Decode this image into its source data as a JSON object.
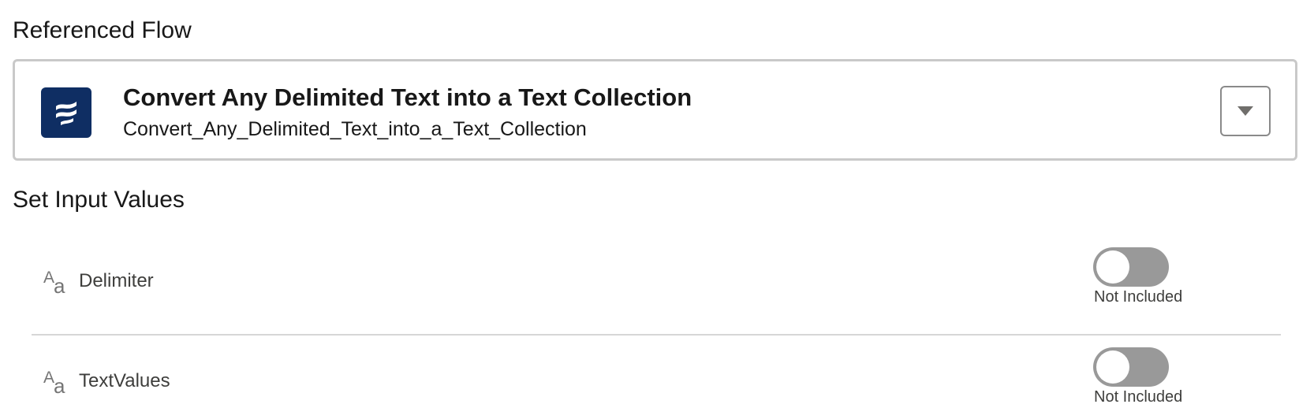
{
  "headings": {
    "referenced_flow": "Referenced Flow",
    "set_input_values": "Set Input Values"
  },
  "flow": {
    "icon": "flow-icon",
    "title": "Convert Any Delimited Text into a Text Collection",
    "api_name": "Convert_Any_Delimited_Text_into_a_Text_Collection",
    "menu_icon": "chevron-down-icon"
  },
  "inputs": [
    {
      "type_icon": "text-type-icon",
      "label": "Delimiter",
      "included": false,
      "status": "Not Included"
    },
    {
      "type_icon": "text-type-icon",
      "label": "TextValues",
      "included": false,
      "status": "Not Included"
    }
  ],
  "colors": {
    "flow_icon_bg": "#0f2e63",
    "toggle_off": "#999999",
    "card_border": "#c9c9c9"
  }
}
